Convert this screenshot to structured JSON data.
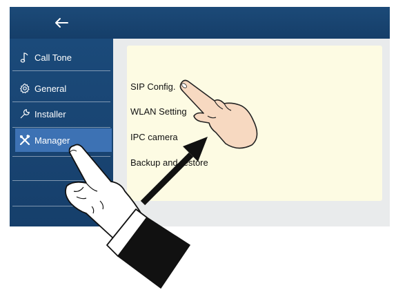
{
  "topbar": {
    "back_icon": "arrow-left-icon"
  },
  "sidebar": {
    "items": [
      {
        "label": "Call Tone",
        "icon": "note-icon"
      },
      {
        "label": "General",
        "icon": "gear-icon"
      },
      {
        "label": "Installer",
        "icon": "wrench-icon"
      },
      {
        "label": "Manager",
        "icon": "tools-icon",
        "active": true
      }
    ]
  },
  "panel": {
    "items": [
      {
        "label": "SIP Config."
      },
      {
        "label": "WLAN Setting"
      },
      {
        "label": "IPC camera"
      },
      {
        "label": "Backup and restore"
      }
    ]
  },
  "colors": {
    "sidebar_bg": "#1b4a7a",
    "active_item": "#3d72b4",
    "panel_bg": "#fdfbe3",
    "screen_bg": "#e9ebec"
  }
}
